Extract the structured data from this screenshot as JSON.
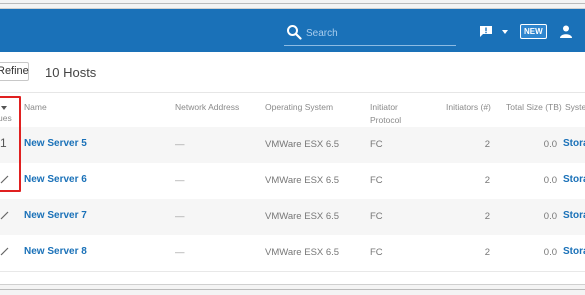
{
  "appbar": {
    "search_placeholder": "Search",
    "new_badge": "NEW",
    "brand_color": "#1a71b8"
  },
  "toolbar": {
    "refine_label": "Refine",
    "host_count": "10 Hosts"
  },
  "table": {
    "headers": {
      "issues": "ues",
      "name": "Name",
      "network_address": "Network Address",
      "operating_system": "Operating System",
      "initiator_protocol": "Initiator Protocol",
      "initiators": "Initiators (#)",
      "total_size": "Total Size (TB)",
      "system": "Syste"
    },
    "rows": [
      {
        "issues": "1",
        "name": "New Server 5",
        "address": "—",
        "os": "VMWare ESX 6.5",
        "protocol": "FC",
        "initiators": "2",
        "size": "0.0",
        "system": "Stora"
      },
      {
        "issues": "",
        "name": "New Server 6",
        "address": "—",
        "os": "VMWare ESX 6.5",
        "protocol": "FC",
        "initiators": "2",
        "size": "0.0",
        "system": "Stora"
      },
      {
        "issues": "",
        "name": "New Server 7",
        "address": "—",
        "os": "VMWare ESX 6.5",
        "protocol": "FC",
        "initiators": "2",
        "size": "0.0",
        "system": "Stora"
      },
      {
        "issues": "",
        "name": "New Server 8",
        "address": "—",
        "os": "VMWare ESX 6.5",
        "protocol": "FC",
        "initiators": "2",
        "size": "0.0",
        "system": "Stora"
      }
    ]
  }
}
